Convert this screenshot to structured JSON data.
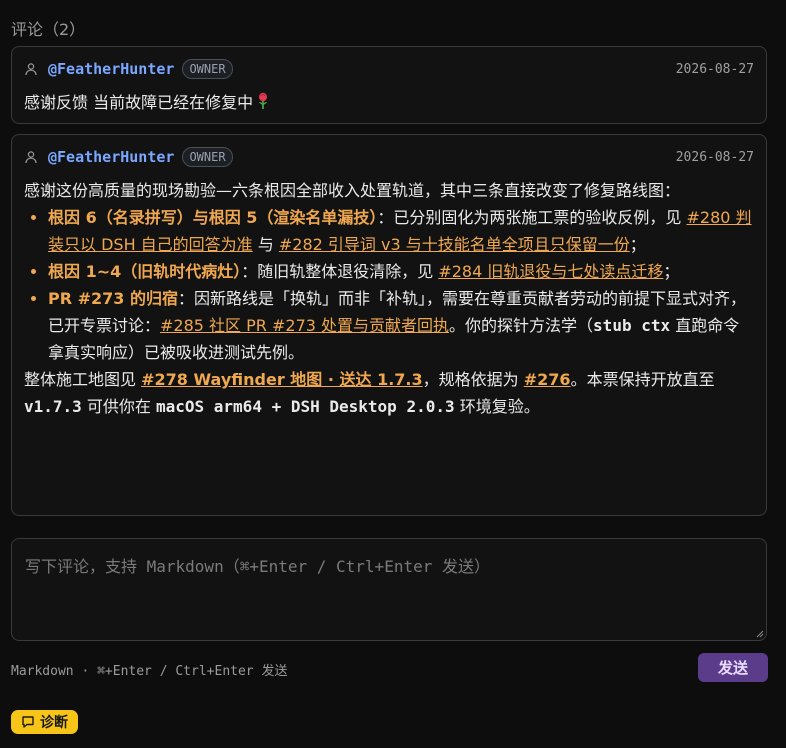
{
  "comments_title": "评论（2）",
  "comments": [
    {
      "author": "@FeatherHunter",
      "badge": "OWNER",
      "date": "2026-08-27",
      "text": "感谢反馈 当前故障已经在修复中",
      "emoji_icon": "rose-icon"
    },
    {
      "author": "@FeatherHunter",
      "badge": "OWNER",
      "date": "2026-08-27",
      "intro": "感谢这份高质量的现场勘验—六条根因全部收入处置轨道，其中三条直接改变了修复路线图：",
      "bullets": [
        {
          "strong": "根因 6（名录拼写）与根因 5（渲染名单漏技）",
          "t1": "：已分别固化为两张施工票的验收反例，见 ",
          "link1": "#280 判装只以 DSH 自己的回答为准",
          "t2": " 与 ",
          "link2": "#282 引导词 v3 与十技能名单全项且只保留一份",
          "t3": "；"
        },
        {
          "strong": "根因 1~4（旧轨时代病灶）",
          "t1": "：随旧轨整体退役清除，见 ",
          "link1": "#284 旧轨退役与七处读点迁移",
          "t3": "；"
        },
        {
          "strong": "PR #273 的归宿",
          "t1": "：因新路线是「换轨」而非「补轨」，需要在尊重贡献者劳动的前提下显式对齐，已开专票讨论：",
          "link1": "#285 社区 PR #273 处置与贡献者回执",
          "t2": "。你的探针方法学（",
          "code1": "stub ctx",
          "t3": " 直跑命令拿真实响应）已被吸收进测试先例。"
        }
      ],
      "outro": {
        "t1": "整体施工地图见 ",
        "link1": "#278 Wayfinder 地图 · 送达 1.7.3",
        "t2": "，规格依据为 ",
        "link2": "#276",
        "t3": "。本票保持开放直至 ",
        "code1": "v1.7.3",
        "t4": " 可供你在 ",
        "code2": "macOS arm64 + DSH Desktop 2.0.3",
        "t5": " 环境复验。"
      }
    }
  ],
  "editor": {
    "placeholder": "写下评论，支持 Markdown（⌘+Enter / Ctrl+Enter 发送）"
  },
  "footer": {
    "hint": "Markdown · ⌘+Enter / Ctrl+Enter 发送",
    "send_label": "发送",
    "diagnose_label": "诊断",
    "diagnose_icon": "chat-bubble-icon"
  },
  "colors": {
    "accent_link": "#f0a850",
    "author": "#7aa7ff",
    "send_bg": "#5b3c8a",
    "diagnose_bg": "#f7c518"
  }
}
